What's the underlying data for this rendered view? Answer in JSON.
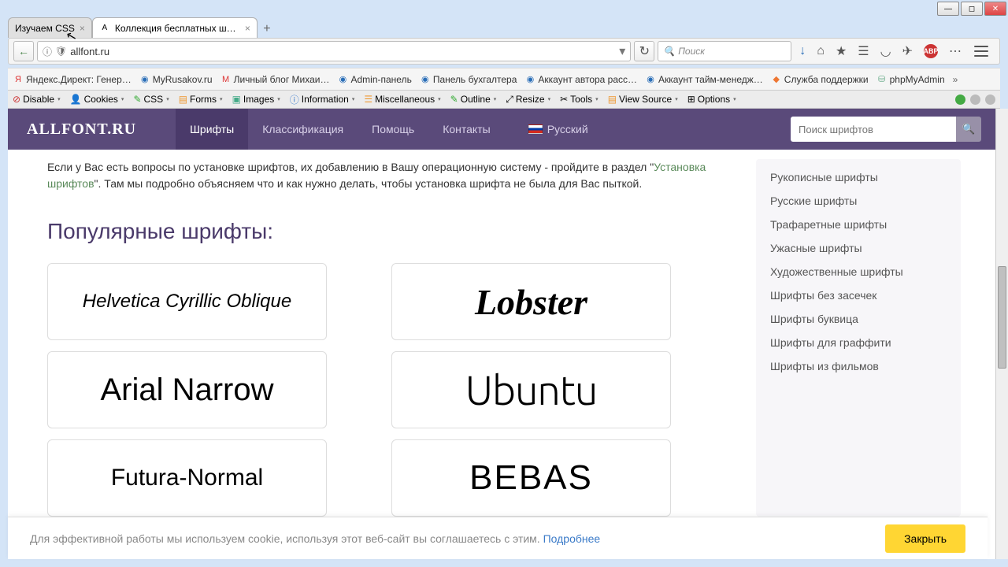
{
  "window": {
    "minimize": "—",
    "maximize": "◻",
    "close": "✕"
  },
  "tabs": {
    "t1": {
      "title": "Изучаем CSS"
    },
    "t2": {
      "title": "Коллекция бесплатных шр…"
    }
  },
  "url": {
    "value": "allfont.ru",
    "dropdown": "▾"
  },
  "search": {
    "placeholder": "Поиск"
  },
  "toolbar_icons": {
    "download": "↓",
    "home": "⌂",
    "star": "★",
    "list": "☰",
    "pocket": "◡",
    "plane": "✈",
    "abp": "ABP",
    "bell": "⋯",
    "menu": "≡"
  },
  "bookmarks": [
    "Яндекс.Директ: Генер…",
    "MyRusakov.ru",
    "Личный блог Михаи…",
    "Admin-панель",
    "Панель бухгалтера",
    "Аккаунт автора расс…",
    "Аккаунт тайм-менедж…",
    "Служба поддержки",
    "phpMyAdmin"
  ],
  "bm_more": "»",
  "devbar": [
    "Disable",
    "Cookies",
    "CSS",
    "Forms",
    "Images",
    "Information",
    "Miscellaneous",
    "Outline",
    "Resize",
    "Tools",
    "View Source",
    "Options"
  ],
  "site": {
    "logo": "ALLFONT.RU",
    "nav": [
      "Шрифты",
      "Классификация",
      "Помощь",
      "Контакты"
    ],
    "lang": "Русский",
    "search_placeholder": "Поиск шрифтов",
    "search_btn": "🔍"
  },
  "main": {
    "para_prefix": "Если у Вас есть вопросы по установке шрифтов, их добавлению в Вашу операционную систему - пройдите в раздел \"",
    "link": "Установка шрифтов",
    "para_suffix": "\". Там мы подробно объясняем что и как нужно делать, чтобы установка шрифта не была для Вас пыткой.",
    "heading": "Популярные шрифты:",
    "fonts": {
      "f1": "Helvetica Cyrillic Oblique",
      "f2": "Lobster",
      "f3": "Arial Narrow",
      "f4": "Ubuntu",
      "f5": "Futura-Normal",
      "f6": "BEBAS"
    }
  },
  "sidebar": [
    "Рукописные шрифты",
    "Русские шрифты",
    "Трафаретные шрифты",
    "Ужасные шрифты",
    "Художественные шрифты",
    "Шрифты без засечек",
    "Шрифты буквица",
    "Шрифты для граффити",
    "Шрифты из фильмов"
  ],
  "cookie": {
    "text": "Для эффективной работы мы используем cookie, используя этот веб-сайт вы соглашаетесь с этим. ",
    "link": "Подробнее",
    "close": "Закрыть"
  }
}
